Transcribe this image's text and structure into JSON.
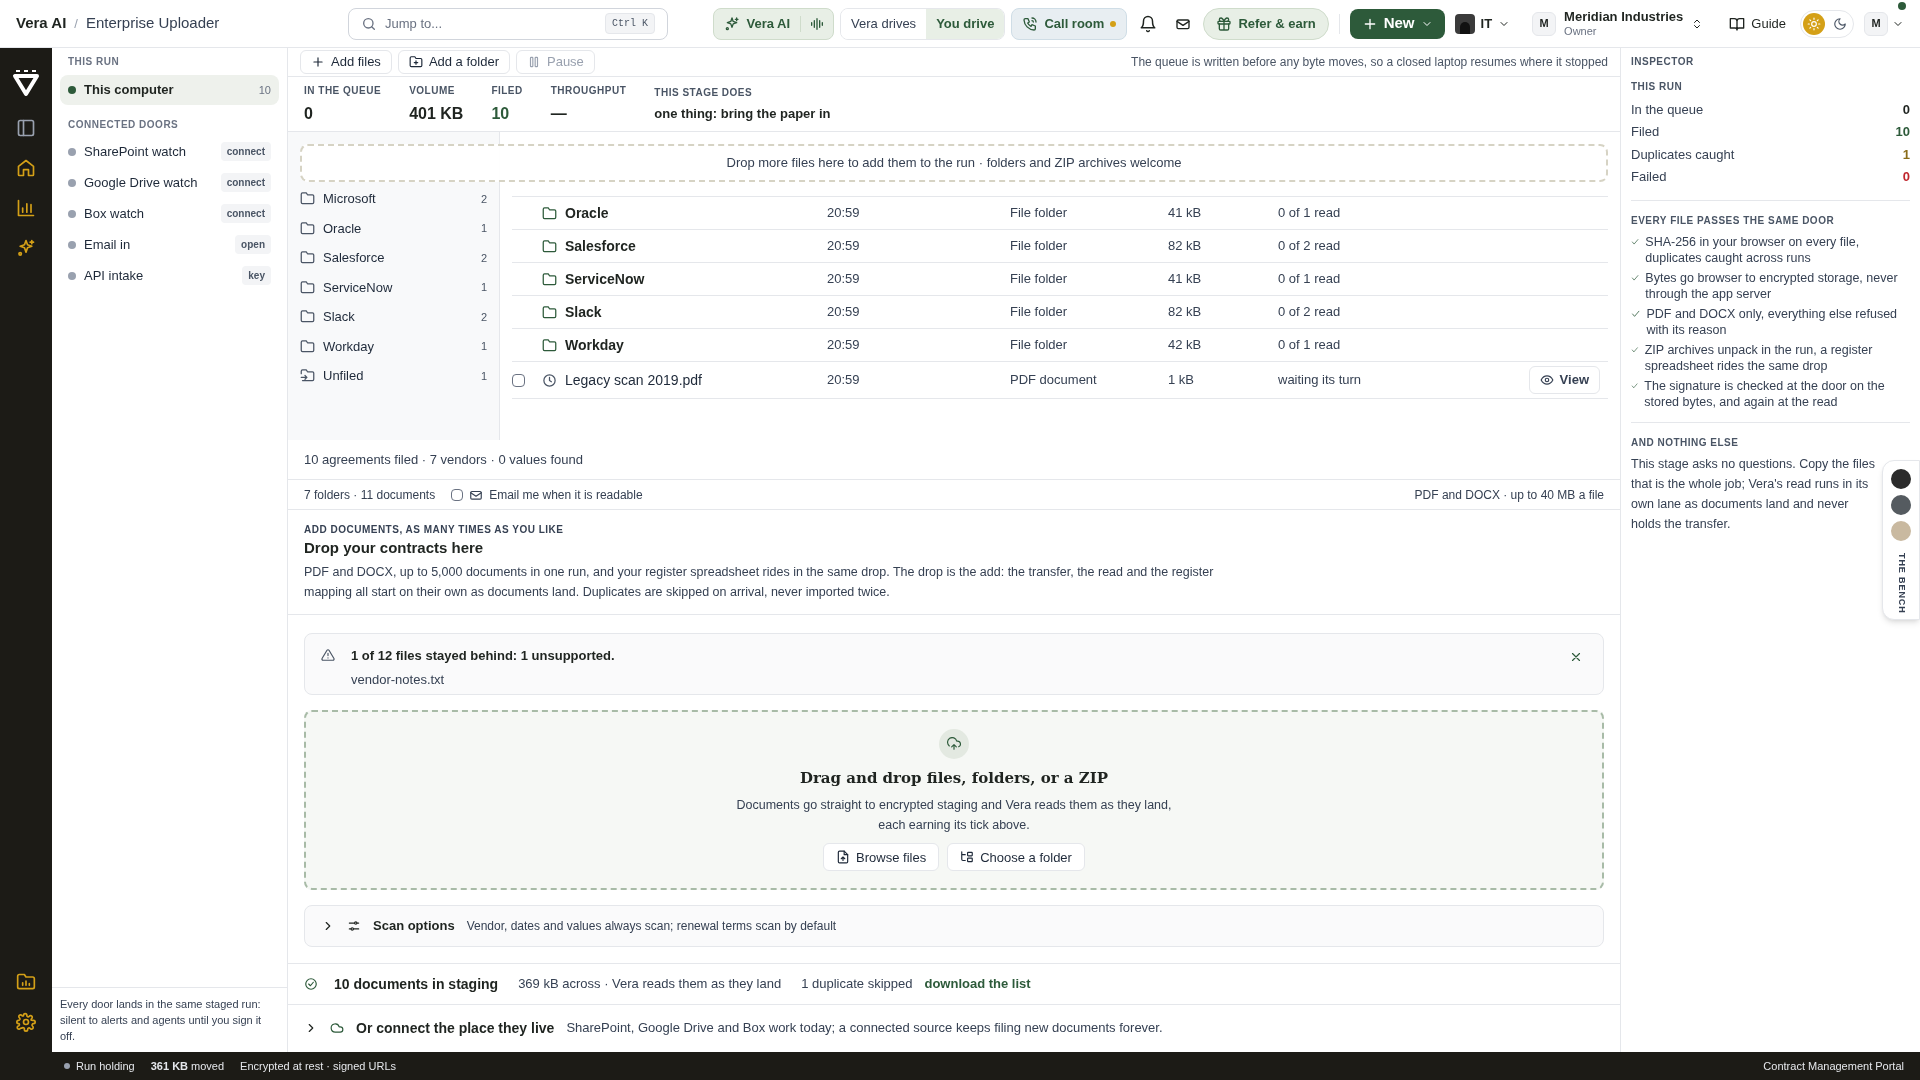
{
  "header": {
    "breadcrumb": [
      "Vera AI",
      "Enterprise Uploader"
    ],
    "separator": "/",
    "search": {
      "placeholder": "Jump to...",
      "shortcut": "Ctrl K"
    },
    "assistant_button": "Vera AI",
    "drive_modes": [
      {
        "label": "Vera drives",
        "selected": false
      },
      {
        "label": "You drive",
        "selected": true
      }
    ],
    "call_room": {
      "label": "Call room",
      "live": true
    },
    "refer": "Refer & earn",
    "new_button": "New",
    "team": "IT",
    "org": {
      "initial": "M",
      "name": "Meridian Industries",
      "role": "Owner"
    },
    "guide": "Guide",
    "theme": [
      {
        "kind": "light",
        "selected": true
      },
      {
        "kind": "dark",
        "selected": false
      }
    ],
    "user": {
      "initial": "M",
      "online": true
    }
  },
  "sidebar": {
    "run_heading": "THIS RUN",
    "run_items": [
      {
        "label": "This computer",
        "count": "10",
        "selected": true
      }
    ],
    "doors_heading": "CONNECTED DOORS",
    "doors": [
      {
        "label": "SharePoint watch",
        "badge": "connect"
      },
      {
        "label": "Google Drive watch",
        "badge": "connect"
      },
      {
        "label": "Box watch",
        "badge": "connect"
      },
      {
        "label": "Email in",
        "badge": "open"
      },
      {
        "label": "API intake",
        "badge": "key"
      }
    ],
    "footnote": "Every door lands in the same staged run: silent to alerts and agents until you sign it off."
  },
  "toolbar": {
    "buttons": [
      {
        "kind": "add",
        "label": "Add files",
        "disabled": false
      },
      {
        "kind": "folder",
        "label": "Add a folder",
        "disabled": false
      },
      {
        "kind": "pause",
        "label": "Pause",
        "disabled": true
      }
    ],
    "note": "The queue is written before any byte moves, so a closed laptop resumes where it stopped"
  },
  "stats": [
    {
      "label": "IN THE QUEUE",
      "value": "0",
      "color": "#1f2420"
    },
    {
      "label": "VOLUME",
      "value": "401 KB",
      "color": "#1f2420"
    },
    {
      "label": "FILED",
      "value": "10",
      "color": "#2d5a3a"
    },
    {
      "label": "THROUGHPUT",
      "value": "—",
      "color": "#1f2420"
    },
    {
      "label": "THIS STAGE DOES",
      "value": "one thing: bring the paper in",
      "color": "#1f2420"
    }
  ],
  "drop_banner": "Drop more files here to add them to the run · folders and ZIP archives welcome",
  "folders": [
    {
      "kind": "folder",
      "name": "Microsoft",
      "count": "2"
    },
    {
      "kind": "folder",
      "name": "Oracle",
      "count": "1"
    },
    {
      "kind": "folder",
      "name": "Salesforce",
      "count": "2"
    },
    {
      "kind": "folder",
      "name": "ServiceNow",
      "count": "1"
    },
    {
      "kind": "folder",
      "name": "Slack",
      "count": "2"
    },
    {
      "kind": "folder",
      "name": "Workday",
      "count": "1"
    },
    {
      "kind": "inbox",
      "name": "Unfiled",
      "count": "1"
    }
  ],
  "rows": [
    {
      "kind": "folder",
      "name": "Oracle",
      "time": "20:59",
      "type": "File folder",
      "size": "41 kB",
      "status": "0 of 1 read"
    },
    {
      "kind": "folder",
      "name": "Salesforce",
      "time": "20:59",
      "type": "File folder",
      "size": "82 kB",
      "status": "0 of 2 read"
    },
    {
      "kind": "folder",
      "name": "ServiceNow",
      "time": "20:59",
      "type": "File folder",
      "size": "41 kB",
      "status": "0 of 1 read"
    },
    {
      "kind": "folder",
      "name": "Slack",
      "time": "20:59",
      "type": "File folder",
      "size": "82 kB",
      "status": "0 of 2 read"
    },
    {
      "kind": "folder",
      "name": "Workday",
      "time": "20:59",
      "type": "File folder",
      "size": "42 kB",
      "status": "0 of 1 read"
    },
    {
      "kind": "file",
      "checked": false,
      "name": "Legacy scan 2019.pdf",
      "time": "20:59",
      "type": "PDF document",
      "size": "1 kB",
      "status": "waiting its turn",
      "action": "View"
    }
  ],
  "summary": "10 agreements filed · 7 vendors · 0 values found",
  "list_footer": {
    "counts": "7 folders · 11 documents",
    "email_opt_in": {
      "label": "Email me when it is readable",
      "checked": false
    },
    "limits": "PDF and DOCX · up to 40 MB a file"
  },
  "add_section": {
    "eyebrow": "ADD DOCUMENTS, AS MANY TIMES AS YOU LIKE",
    "title": "Drop your contracts here",
    "body": "PDF and DOCX, up to 5,000 documents in one run, and your register spreadsheet rides in the same drop. The drop is the add: the transfer, the read and the register mapping all start on their own as documents land. Duplicates are skipped on arrival, never imported twice."
  },
  "alert": {
    "title": "1 of 12 files stayed behind: 1 unsupported.",
    "files": [
      "vendor-notes.txt"
    ]
  },
  "dropzone": {
    "title": "Drag and drop files, folders, or a ZIP",
    "body": "Documents go straight to encrypted staging and Vera reads them as they land, each earning its tick above.",
    "buttons": [
      {
        "kind": "files",
        "label": "Browse files"
      },
      {
        "kind": "folder",
        "label": "Choose a folder"
      }
    ]
  },
  "scan_options": {
    "title": "Scan options",
    "detail": "Vendor, dates and values always scan; renewal terms scan by default",
    "expanded": false
  },
  "staging": {
    "title": "10 documents in staging",
    "detail": "369 kB across · Vera reads them as they land",
    "duplicates": "1 duplicate skipped",
    "link": "download the list"
  },
  "connect": {
    "title": "Or connect the place they live",
    "detail": "SharePoint, Google Drive and Box work today; a connected source keeps filing new documents forever.",
    "expanded": false
  },
  "inspector": {
    "heading": "INSPECTOR",
    "run_heading": "THIS RUN",
    "metrics": [
      {
        "label": "In the queue",
        "value": "0",
        "color": "#1f2420"
      },
      {
        "label": "Filed",
        "value": "10",
        "color": "#2d5a3a"
      },
      {
        "label": "Duplicates caught",
        "value": "1",
        "color": "#8a6d1a"
      },
      {
        "label": "Failed",
        "value": "0",
        "color": "#c0262d"
      }
    ],
    "door_heading": "EVERY FILE PASSES THE SAME DOOR",
    "checks": [
      "SHA-256 in your browser on every file, duplicates caught across runs",
      "Bytes go browser to encrypted storage, never through the app server",
      "PDF and DOCX only, everything else refused with its reason",
      "ZIP archives unpack in the run, a register spreadsheet rides the same drop",
      "The signature is checked at the door on the stored bytes, and again at the read"
    ],
    "else_heading": "AND NOTHING ELSE",
    "else_body": "This stage asks no questions. Copy the files that is the whole job; Vera's read runs in its own lane as documents land and never holds the transfer."
  },
  "bench": {
    "label": "THE BENCH"
  },
  "status_bar": {
    "state": "Run holding",
    "moved": "**361 KB** moved",
    "security": "Encrypted at rest · signed URLs",
    "portal": "Contract Management Portal"
  }
}
